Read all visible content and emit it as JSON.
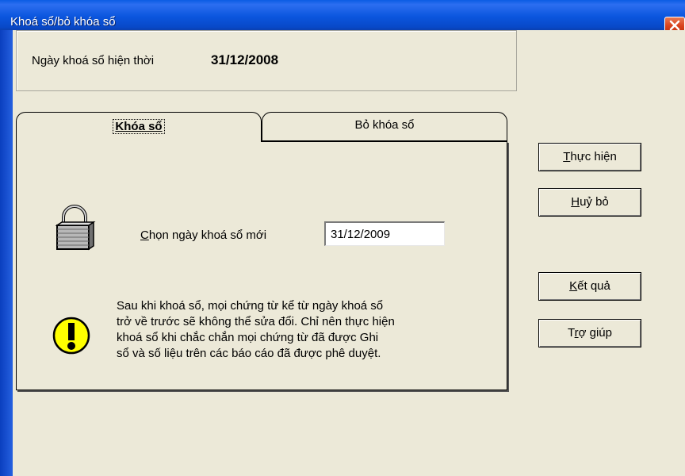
{
  "window": {
    "title": "Khoá sổ/bỏ khóa sổ"
  },
  "current": {
    "label": "Ngày khoá sổ hiện thời",
    "value": "31/12/2008"
  },
  "tabs": [
    {
      "label": "Khóa sổ",
      "selected": true
    },
    {
      "label": "Bỏ khóa sổ",
      "selected": false
    }
  ],
  "lock_tab": {
    "new_date_label": "Chọn ngày khoá sổ mới",
    "new_date_value": "31/12/2009",
    "warning": "Sau khi khoá sổ, mọi chứng từ kể từ ngày khoá sổ\ntrở về trước sẽ không thể sửa đổi. Chỉ nên thực hiện\nkhoá sổ khi chắc chắn mọi chứng từ đã được Ghi\nsổ và số liệu trên các báo cáo đã được phê duyệt."
  },
  "buttons": {
    "execute": "Thực hiện",
    "cancel": "Huỷ bỏ",
    "result": "Kết quả",
    "help": "Trợ giúp"
  },
  "icons": {
    "close": "close-icon",
    "lock": "padlock-icon",
    "warning": "warning-icon"
  },
  "colors": {
    "titlebar": "#0b56de",
    "client": "#ece9d8",
    "close": "#d9431e",
    "warning": "#ffff00"
  }
}
